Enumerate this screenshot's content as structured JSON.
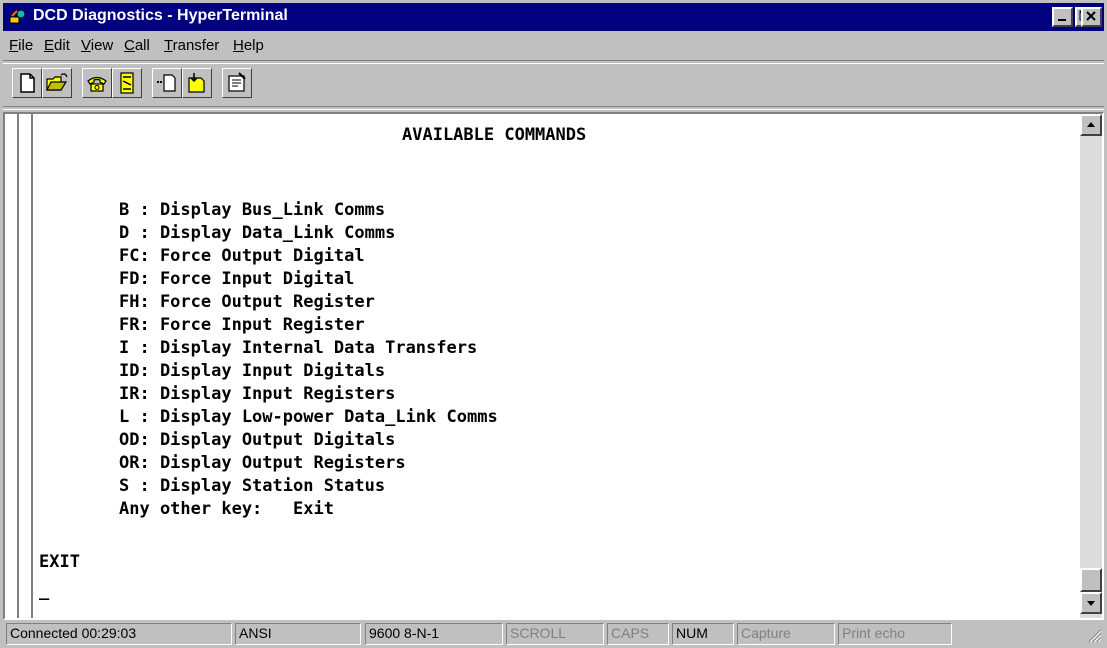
{
  "window": {
    "title": "DCD Diagnostics - HyperTerminal"
  },
  "title_buttons": {
    "minimize": "minimize",
    "maximize": "maximize",
    "close": "close"
  },
  "menu": {
    "items": [
      {
        "label": "File",
        "mnemonic": "F"
      },
      {
        "label": "Edit",
        "mnemonic": "E"
      },
      {
        "label": "View",
        "mnemonic": "V"
      },
      {
        "label": "Call",
        "mnemonic": "C"
      },
      {
        "label": "Transfer",
        "mnemonic": "T"
      },
      {
        "label": "Help",
        "mnemonic": "H"
      }
    ]
  },
  "toolbar": {
    "icons": [
      "new-document-icon",
      "open-folder-icon",
      "connect-phone-icon",
      "disconnect-phone-icon",
      "send-file-icon",
      "receive-file-icon",
      "properties-icon"
    ]
  },
  "terminal": {
    "heading": "AVAILABLE COMMANDS",
    "commands": [
      "B : Display Bus_Link Comms",
      "D : Display Data_Link Comms",
      "FC: Force Output Digital",
      "FD: Force Input Digital",
      "FH: Force Output Register",
      "FR: Force Input Register",
      "I : Display Internal Data Transfers",
      "ID: Display Input Digitals",
      "IR: Display Input Registers",
      "L : Display Low-power Data_Link Comms",
      "OD: Display Output Digitals",
      "OR: Display Output Registers",
      "S : Display Station Status",
      "Any other key:   Exit"
    ],
    "exit_text": "EXIT",
    "cursor": "_"
  },
  "status": {
    "connection": "Connected 00:29:03",
    "emulation": "ANSI",
    "settings": "9600 8-N-1",
    "scroll": "SCROLL",
    "caps": "CAPS",
    "num": "NUM",
    "capture": "Capture",
    "print_echo": "Print echo"
  },
  "colors": {
    "titlebar": "#000080",
    "chrome": "#c0c0c0",
    "terminal_bg": "#ffffff"
  }
}
